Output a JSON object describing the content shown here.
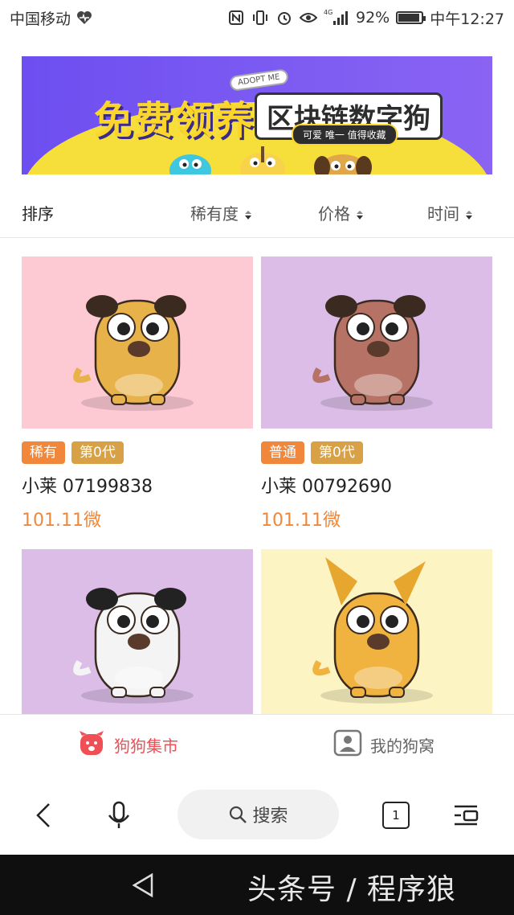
{
  "status_bar": {
    "carrier": "中国移动",
    "network": "4G",
    "battery": "92%",
    "battery_fraction": 0.92,
    "time": "中午12:27"
  },
  "banner": {
    "adopt_label": "ADOPT ME",
    "title": "免费领养",
    "subtitle": "区块链数字狗",
    "tagline": "可爱 唯一 值得收藏"
  },
  "sort": {
    "title": "排序",
    "options": [
      "稀有度",
      "价格",
      "时间"
    ]
  },
  "dogs": [
    {
      "rarity": "稀有",
      "generation": "第0代",
      "name": "小莱 07199838",
      "price": "101.11微",
      "bg": "#fdc9d3",
      "fur": "#e8b24a"
    },
    {
      "rarity": "普通",
      "generation": "第0代",
      "name": "小莱 00792690",
      "price": "101.11微",
      "bg": "#dcbde8",
      "fur": "#b77266"
    },
    {
      "bg": "#dcbde8",
      "fur": "#f4f4f4"
    },
    {
      "bg": "#fdf4c3",
      "fur": "#f0b33f"
    }
  ],
  "tabs": {
    "market": "狗狗集市",
    "my_kennel": "我的狗窝"
  },
  "browser": {
    "search_label": "搜索",
    "tab_count": "1"
  },
  "watermark": "头条号 / 程序狼",
  "colors": {
    "accent": "#f04f55",
    "price": "#f0873a",
    "rare_tag": "#f0873a",
    "gen_tag": "#d8a145"
  }
}
